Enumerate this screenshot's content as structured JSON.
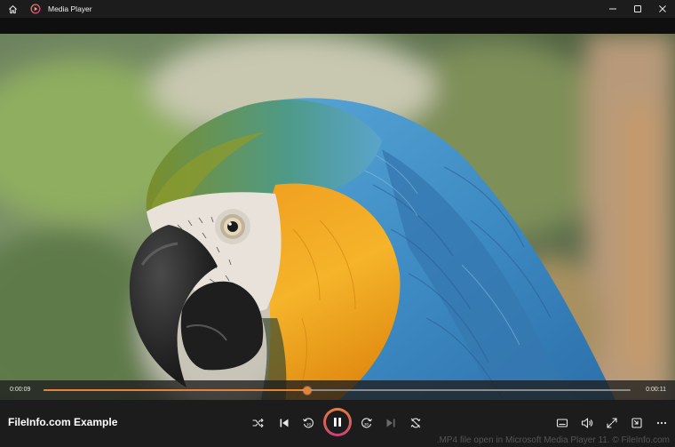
{
  "window": {
    "title": "Media Player"
  },
  "video": {
    "subject": "parrot-video-frame"
  },
  "playback": {
    "current_time": "0:00:09",
    "total_time": "0:00:11",
    "progress": 0.45,
    "state": "playing"
  },
  "media": {
    "title": "FileInfo.com Example"
  },
  "controls": {
    "shuffle_icon": "shuffle-icon",
    "previous_icon": "previous-icon",
    "rewind_icon": "rewind-10-icon",
    "pause_icon": "pause-icon",
    "forward_icon": "forward-30-icon",
    "next_icon": "next-icon",
    "repeat_icon": "repeat-off-icon",
    "subtitles_icon": "subtitles-icon",
    "volume_icon": "volume-icon",
    "fullscreen_icon": "fullscreen-icon",
    "miniplayer_icon": "miniplayer-icon",
    "more_icon": "more-icon"
  },
  "colors": {
    "accent": "#e8823a",
    "accent2": "#c8407a"
  },
  "caption": ".MP4 file open in Microsoft Media Player 11. © FileInfo.com"
}
